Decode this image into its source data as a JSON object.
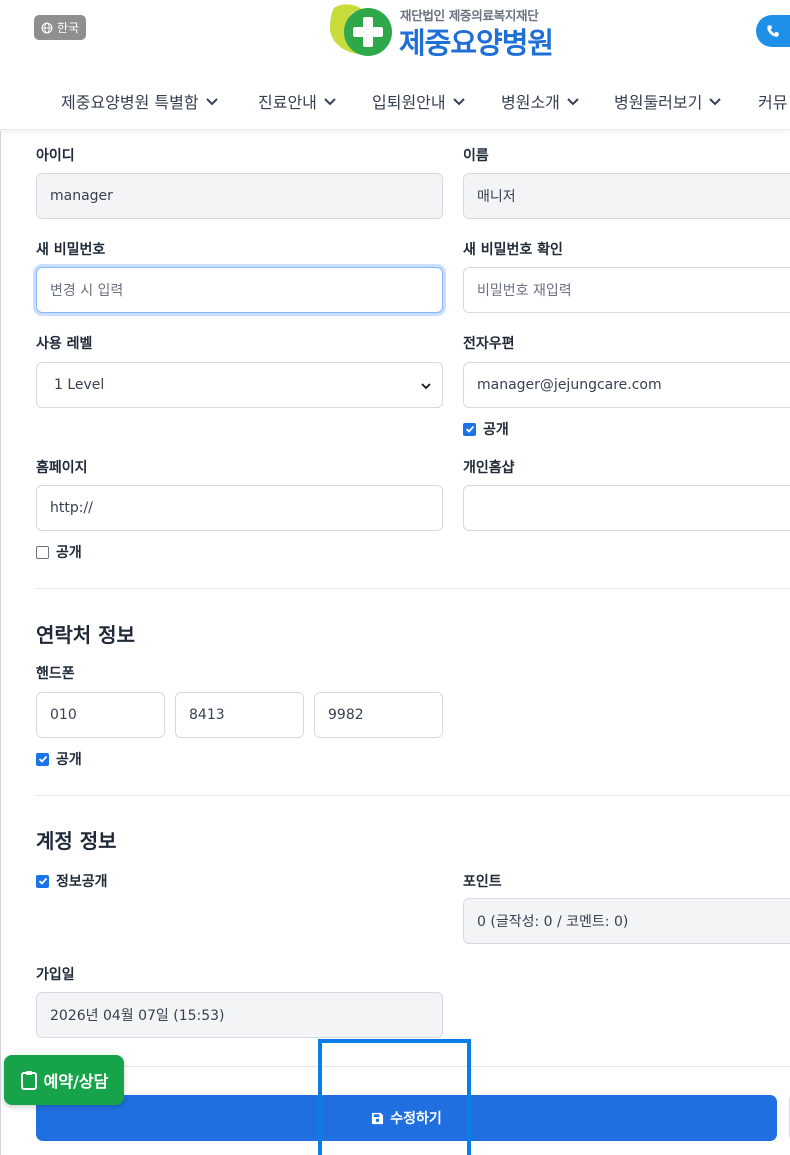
{
  "header": {
    "lang_label": "한국",
    "logo_sub": "재단법인 제중의료복지재단",
    "logo_main": "제중요양병원",
    "call_label": "전"
  },
  "nav": {
    "items": [
      {
        "label": "제중요양병원 특별함"
      },
      {
        "label": "진료안내"
      },
      {
        "label": "입퇴원안내"
      },
      {
        "label": "병원소개"
      },
      {
        "label": "병원둘러보기"
      },
      {
        "label": "커뮤"
      }
    ]
  },
  "form": {
    "userid": {
      "label": "아이디",
      "value": "manager"
    },
    "name": {
      "label": "이름",
      "value": "매니저"
    },
    "new_password": {
      "label": "새 비밀번호",
      "placeholder": "변경 시 입력"
    },
    "new_password_confirm": {
      "label": "새 비밀번호 확인",
      "placeholder": "비밀번호 재입력"
    },
    "level": {
      "label": "사용 레벨",
      "value": "1 Level"
    },
    "email": {
      "label": "전자우편",
      "value": "manager@jejungcare.com",
      "public_label": "공개",
      "public_checked": true
    },
    "homepage": {
      "label": "홈페이지",
      "value": "http://",
      "public_label": "공개",
      "public_checked": false
    },
    "blog": {
      "label": "개인홈샵",
      "value": ""
    }
  },
  "contact": {
    "title": "연락처 정보",
    "phone_label": "핸드폰",
    "phone": [
      "010",
      "8413",
      "9982"
    ],
    "public_label": "공개",
    "public_checked": true
  },
  "account": {
    "title": "계정 정보",
    "info_public_label": "정보공개",
    "info_public_checked": true,
    "point_label": "포인트",
    "point_value": "0 (글작성: 0 / 코멘트: 0)",
    "joined_label": "가입일",
    "joined_value": "2026년 04월 07일 (15:53)"
  },
  "actions": {
    "submit_label": "수정하기"
  },
  "floating": {
    "reserve_label": "예약/상담"
  },
  "colors": {
    "primary": "#1f6fe0",
    "logo_blue": "#1f6fd6",
    "logo_green": "#2ea84b",
    "float_green": "#16a34a",
    "highlight": "#0a7ee6"
  }
}
